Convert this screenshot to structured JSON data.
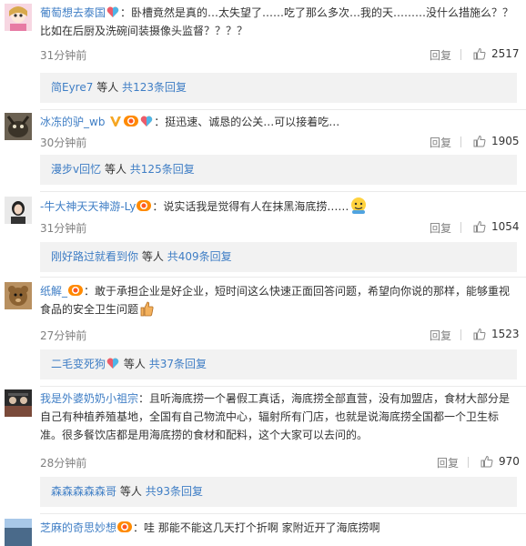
{
  "ui": {
    "reply_label": "回复",
    "others_word": "等人",
    "total_word": "共",
    "replies_suffix": "条回复"
  },
  "comments": [
    {
      "user": "葡萄想去泰国",
      "badges": [
        "heart-rainbow-icon"
      ],
      "text": "：卧槽竟然是真的…太失望了……吃了那么多次…我的天………没什么措施么？？比如在后厨及洗碗间装摄像头监督？？？？",
      "time": "31分钟前",
      "likes": "2517",
      "sub": {
        "user": "简Eyre7",
        "count": "123"
      }
    },
    {
      "user": "冰冻的驴_wb",
      "badges": [
        "v-badge-icon",
        "vip-icon",
        "heart-rainbow-icon"
      ],
      "text": "：挺迅速、诚恳的公关…可以接着吃…",
      "time": "30分钟前",
      "likes": "1905",
      "sub": {
        "user": "漫步v回忆",
        "count": "125"
      }
    },
    {
      "user": "-牛大神天天神游-Ly",
      "badges": [
        "vip-icon"
      ],
      "text": "：说实话我是觉得有人在抹黑海底捞……",
      "emoji_end": "smiley-icon",
      "time": "31分钟前",
      "likes": "1054",
      "sub": {
        "user": "刚好路过就看到你",
        "count": "409"
      }
    },
    {
      "user": "纸解_",
      "badges": [
        "vip-icon"
      ],
      "text": "：敢于承担企业是好企业，短时间这么快速正面回答问题，希望向你说的那样，能够重视食品的安全卫生问题",
      "emoji_end": "thumbs-up-icon",
      "time": "27分钟前",
      "likes": "1523",
      "sub": {
        "user": "二毛变死狗",
        "count": "37",
        "badges": [
          "heart-rainbow-icon"
        ]
      }
    },
    {
      "user": "我是外婆奶奶小祖宗",
      "badges": [],
      "text": "：且听海底捞一个暑假工真话，海底捞全部直营，没有加盟店，食材大部分是自己有种植养殖基地，全国有自己物流中心，辐射所有门店，也就是说海底捞全国都一个卫生标准。很多餐饮店都是用海底捞的食材和配料，这个大家可以去问的。",
      "time": "28分钟前",
      "likes": "970",
      "sub": {
        "user": "森森森森森哥",
        "count": "93"
      }
    },
    {
      "user": "芝麻的奇思妙想",
      "badges": [
        "vip-icon"
      ],
      "text": "：哇 那能不能这几天打个折啊 家附近开了海底捞啊"
    }
  ]
}
